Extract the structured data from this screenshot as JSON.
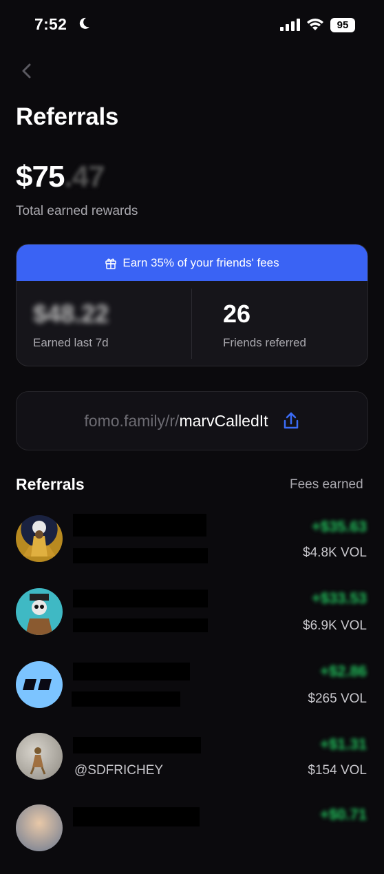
{
  "status_bar": {
    "time": "7:52",
    "battery": "95"
  },
  "header": {
    "title": "Referrals"
  },
  "totals": {
    "amount_whole": "$75",
    "amount_cents": ".47",
    "label": "Total earned rewards"
  },
  "rewards_card": {
    "banner": "Earn 35% of your friends' fees",
    "earned_value": "$48.22",
    "earned_label": "Earned last 7d",
    "friends_value": "26",
    "friends_label": "Friends referred"
  },
  "referral_link": {
    "prefix": "fomo.family/r/",
    "code": "marvCalledIt"
  },
  "referrals_section": {
    "title": "Referrals",
    "right_label": "Fees earned"
  },
  "referrals": [
    {
      "handle": "",
      "fee": "+$35.63",
      "volume": "$4.8K VOL"
    },
    {
      "handle": "",
      "fee": "+$33.53",
      "volume": "$6.9K VOL"
    },
    {
      "handle": "",
      "fee": "+$2.86",
      "volume": "$265 VOL"
    },
    {
      "handle": "@SDFRICHEY",
      "fee": "+$1.31",
      "volume": "$154 VOL"
    },
    {
      "handle": "",
      "fee": "+$0.71",
      "volume": ""
    }
  ],
  "colors": {
    "accent_blue": "#3a63f4",
    "positive_green": "#22c55e",
    "background": "#0b0a0d"
  },
  "icons": [
    "moon-icon",
    "signal-icon",
    "wifi-icon",
    "back-chevron-icon",
    "gift-icon",
    "share-icon"
  ]
}
